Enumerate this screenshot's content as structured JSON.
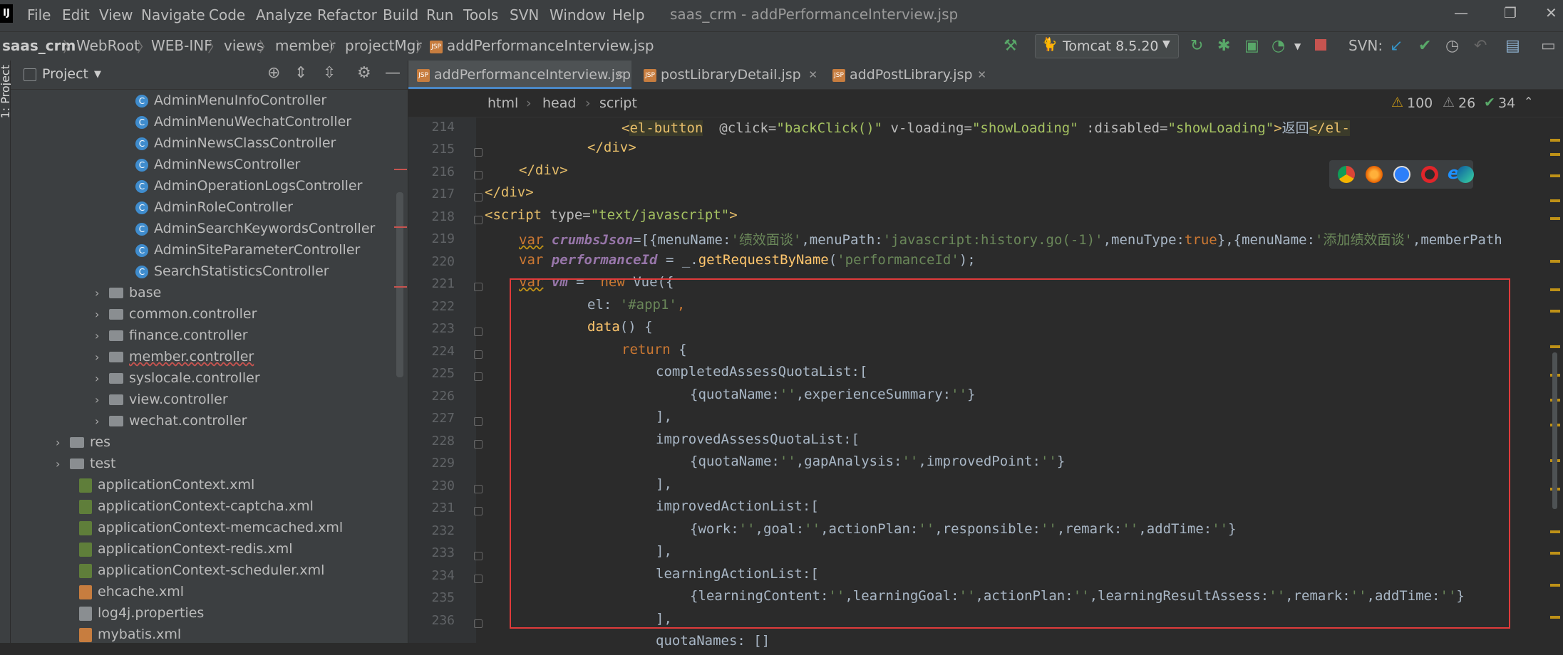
{
  "menubar": {
    "items": [
      "File",
      "Edit",
      "View",
      "Navigate",
      "Code",
      "Analyze",
      "Refactor",
      "Build",
      "Run",
      "Tools",
      "SVN",
      "Window",
      "Help"
    ],
    "title": "saas_crm - addPerformanceInterview.jsp"
  },
  "navbar": {
    "crumbs": [
      "saas_crm",
      "WebRoot",
      "WEB-INF",
      "views",
      "member",
      "projectMgr",
      "addPerformanceInterview.jsp"
    ],
    "run_config": "Tomcat 8.5.20",
    "svn_label": "SVN:"
  },
  "leftstrip": {
    "label": "1: Project"
  },
  "project": {
    "title": "Project",
    "classes": [
      "AdminMenuInfoController",
      "AdminMenuWechatController",
      "AdminNewsClassController",
      "AdminNewsController",
      "AdminOperationLogsController",
      "AdminRoleController",
      "AdminSearchKeywordsController",
      "AdminSiteParameterController",
      "SearchStatisticsController"
    ],
    "packages": [
      "base",
      "common.controller",
      "finance.controller",
      "member.controller",
      "syslocale.controller",
      "view.controller",
      "wechat.controller"
    ],
    "folders": [
      "res",
      "test"
    ],
    "files": [
      "applicationContext.xml",
      "applicationContext-captcha.xml",
      "applicationContext-memcached.xml",
      "applicationContext-redis.xml",
      "applicationContext-scheduler.xml",
      "ehcache.xml",
      "log4j.properties",
      "mybatis.xml"
    ]
  },
  "tabs": [
    "addPerformanceInterview.jsp",
    "postLibraryDetail.jsp",
    "addPostLibrary.jsp"
  ],
  "breadcrumb": [
    "html",
    "head",
    "script"
  ],
  "inspections": {
    "warnings": "100",
    "weak_warnings": "26",
    "ok": "34"
  },
  "lines": {
    "numbers": [
      "214",
      "215",
      "216",
      "217",
      "218",
      "219",
      "220",
      "221",
      "222",
      "223",
      "224",
      "225",
      "226",
      "227",
      "228",
      "229",
      "230",
      "231",
      "232",
      "233",
      "234",
      "235",
      "236"
    ],
    "l214_tag": "el-button",
    "l214_a1": "@click=",
    "l214_v1": "\"backClick()\"",
    "l214_a2": "v-loading=",
    "l214_v2": "\"showLoading\"",
    "l214_a3": ":disabled=",
    "l214_v3": "\"showLoading\"",
    "l214_text": "返回",
    "l214_close": "</el-",
    "l215": "</div>",
    "l216": "</div>",
    "l217": "</div>",
    "l218_tag": "<script",
    "l218_attr": "type=",
    "l218_val": "\"text/javascript\"",
    "l218_end": ">",
    "l219_kw": "var",
    "l219_var": "crumbsJson",
    "l219_rest1": "=[{menuName:",
    "l219_s1": "'绩效面谈'",
    "l219_rest2": ",menuPath:",
    "l219_s2": "'javascript:history.go(-1)'",
    "l219_rest3": ",menuType:",
    "l219_kw2": "true",
    "l219_rest4": "},{menuName:",
    "l219_s3": "'添加绩效面谈'",
    "l219_rest5": ",memberPath",
    "l220_kw": "var",
    "l220_var": "performanceId",
    "l220_rest1": " = _.",
    "l220_fn": "getRequestByName",
    "l220_rest2": "(",
    "l220_s": "'performanceId'",
    "l220_rest3": ");",
    "l221_kw": "var",
    "l221_var": "vm",
    "l221_rest1": " =  ",
    "l221_kw2": "new",
    "l221_rest2": " Vue({",
    "l222_a": "el: ",
    "l222_s": "'#app1'",
    "l222_c": ",",
    "l223_fn": "data",
    "l223_rest": "() {",
    "l224_kw": "return",
    "l224_rest": " {",
    "l225": "completedAssessQuotaList:[",
    "l226_a": "{quotaName:",
    "l226_s1": "''",
    "l226_b": ",experienceSummary:",
    "l226_s2": "''",
    "l226_c": "}",
    "l227": "],",
    "l228": "improvedAssessQuotaList:[",
    "l229_a": "{quotaName:",
    "l229_s1": "''",
    "l229_b": ",gapAnalysis:",
    "l229_s2": "''",
    "l229_c": ",improvedPoint:",
    "l229_s3": "''",
    "l229_d": "}",
    "l230": "],",
    "l231": "improvedActionList:[",
    "l232_a": "{work:",
    "l232_s1": "''",
    "l232_b": ",goal:",
    "l232_s2": "''",
    "l232_c": ",actionPlan:",
    "l232_s3": "''",
    "l232_d": ",responsible:",
    "l232_s4": "''",
    "l232_e": ",remark:",
    "l232_s5": "''",
    "l232_f": ",addTime:",
    "l232_s6": "''",
    "l232_g": "}",
    "l233": "],",
    "l234": "learningActionList:[",
    "l235_a": "{learningContent:",
    "l235_s1": "''",
    "l235_b": ",learningGoal:",
    "l235_s2": "''",
    "l235_c": ",actionPlan:",
    "l235_s3": "''",
    "l235_d": ",learningResultAssess:",
    "l235_s4": "''",
    "l235_e": ",remark:",
    "l235_s5": "''",
    "l235_f": ",addTime:",
    "l235_s6": "''",
    "l235_g": "}",
    "l236": "],",
    "l237": "quotaNames: []"
  },
  "colors": {
    "accent": "#4a88c7",
    "highlight_box": "#e03b3b",
    "keyword": "#cc7832",
    "string": "#6a8759"
  }
}
